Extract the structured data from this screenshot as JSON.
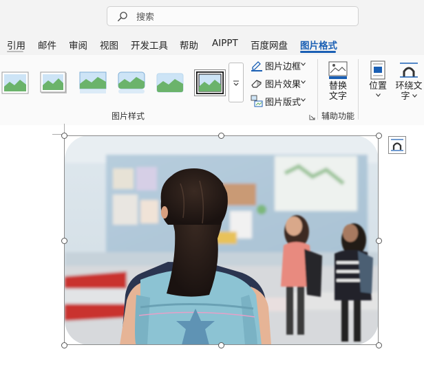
{
  "search": {
    "placeholder": "搜索"
  },
  "tabs": [
    {
      "label": "引用"
    },
    {
      "label": "邮件"
    },
    {
      "label": "审阅"
    },
    {
      "label": "视图"
    },
    {
      "label": "开发工具"
    },
    {
      "label": "帮助"
    },
    {
      "label": "AIPPT"
    },
    {
      "label": "百度网盘"
    },
    {
      "label": "图片格式",
      "active": true
    }
  ],
  "ribbon": {
    "picture_styles": {
      "label": "图片样式",
      "styles": [
        "simple-frame",
        "soft-edge-shadow",
        "reflected-bevel",
        "reflected-rounded",
        "soft-edge-rectangle",
        "thick-black-border"
      ],
      "more_icon": "chevron-down-more-icon"
    },
    "commands": {
      "border": "图片边框",
      "effects": "图片效果",
      "layout": "图片版式"
    },
    "accessibility": {
      "label": "辅助功能",
      "alt_text_line1": "替换",
      "alt_text_line2": "文字"
    },
    "arrange": {
      "position": "位置",
      "wrap_line1": "环绕文",
      "wrap_line2": "字"
    }
  },
  "colors": {
    "accent": "#1a5fb4",
    "tab_bar": "#f3f3f3",
    "ribbon": "#fafafa"
  }
}
